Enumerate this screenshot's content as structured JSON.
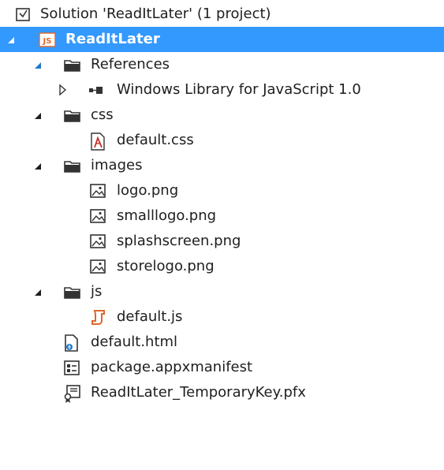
{
  "solution": {
    "label": "Solution 'ReadItLater' (1 project)",
    "icon": "solution-icon"
  },
  "project": {
    "label": "ReadItLater",
    "icon": "javascript-project-icon",
    "selected": true,
    "expanded": true
  },
  "items": [
    {
      "label": "References",
      "icon": "references-folder-icon",
      "expanded": true
    },
    {
      "label": "Windows Library for JavaScript 1.0",
      "icon": "reference-library-icon",
      "expanded": false
    },
    {
      "label": "css",
      "icon": "folder-icon",
      "expanded": true
    },
    {
      "label": "default.css",
      "icon": "css-file-icon"
    },
    {
      "label": "images",
      "icon": "folder-icon",
      "expanded": true
    },
    {
      "label": "logo.png",
      "icon": "image-file-icon"
    },
    {
      "label": "smalllogo.png",
      "icon": "image-file-icon"
    },
    {
      "label": "splashscreen.png",
      "icon": "image-file-icon"
    },
    {
      "label": "storelogo.png",
      "icon": "image-file-icon"
    },
    {
      "label": "js",
      "icon": "folder-icon",
      "expanded": true
    },
    {
      "label": "default.js",
      "icon": "js-file-icon"
    },
    {
      "label": "default.html",
      "icon": "html-file-icon"
    },
    {
      "label": "package.appxmanifest",
      "icon": "manifest-file-icon"
    },
    {
      "label": "ReadItLater_TemporaryKey.pfx",
      "icon": "certificate-file-icon"
    }
  ],
  "colors": {
    "selection_background": "#3399ff",
    "expanded_arrow": "#1e1e1e",
    "js_accent": "#e0662b",
    "css_accent": "#c4312b"
  }
}
